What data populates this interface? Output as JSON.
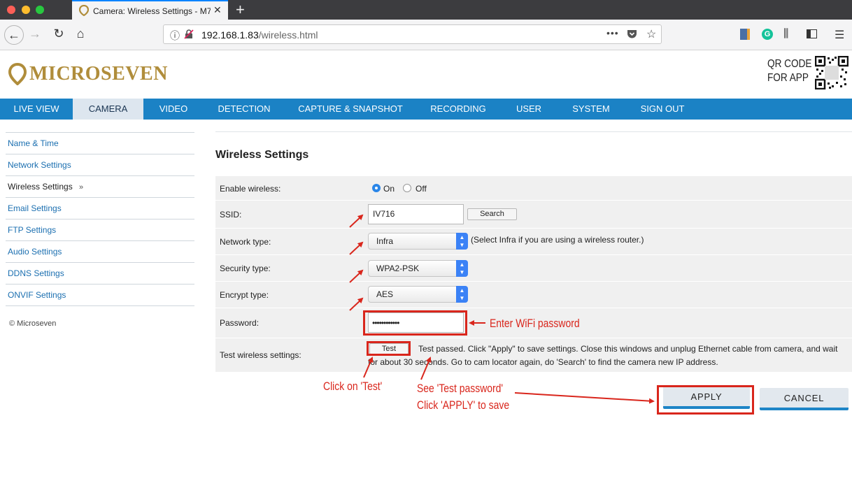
{
  "browser": {
    "tab_title": "Camera: Wireless Settings - M7",
    "url_host": "192.168.1.83",
    "url_path": "/wireless.html"
  },
  "header": {
    "logo": "MICROSEVEN",
    "qr_line1": "QR CODE",
    "qr_line2": "FOR APP"
  },
  "menu": {
    "items": [
      {
        "label": "LIVE VIEW"
      },
      {
        "label": "CAMERA"
      },
      {
        "label": "VIDEO"
      },
      {
        "label": "DETECTION"
      },
      {
        "label": "CAPTURE & SNAPSHOT"
      },
      {
        "label": "RECORDING"
      },
      {
        "label": "USER"
      },
      {
        "label": "SYSTEM"
      },
      {
        "label": "SIGN OUT"
      }
    ],
    "active": "CAMERA"
  },
  "sidebar": {
    "items": [
      {
        "label": "Name & Time"
      },
      {
        "label": "Network Settings"
      },
      {
        "label": "Wireless Settings",
        "suffix": "»"
      },
      {
        "label": "Email Settings"
      },
      {
        "label": "FTP Settings"
      },
      {
        "label": "Audio Settings"
      },
      {
        "label": "DDNS Settings"
      },
      {
        "label": "ONVIF Settings"
      }
    ],
    "copyright": "© Microseven"
  },
  "main": {
    "title": "Wireless Settings",
    "enable_label": "Enable wireless:",
    "on_label": "On",
    "off_label": "Off",
    "ssid_label": "SSID:",
    "ssid_value": "IV716",
    "search_label": "Search",
    "network_label": "Network type:",
    "network_value": "Infra",
    "network_note": "(Select Infra if you are using a wireless router.)",
    "security_label": "Security type:",
    "security_value": "WPA2-PSK",
    "encrypt_label": "Encrypt type:",
    "encrypt_value": "AES",
    "password_label": "Password:",
    "password_value": "••••••••••••",
    "test_label": "Test wireless settings:",
    "test_button": "Test",
    "test_message": "Test passed.  Click \"Apply\" to save settings.  Close this windows and unplug Ethernet cable from camera, and wait for about 30 seconds. Go to cam locator again, do 'Search' to find the camera new IP address.",
    "apply_label": "APPLY",
    "cancel_label": "CANCEL"
  },
  "annotations": {
    "enter_wifi": "Enter WiFi password",
    "click_test": "Click on 'Test'",
    "see_test_1": "See 'Test password'",
    "see_test_2": "Click 'APPLY' to save"
  },
  "colors": {
    "menu_bar": "#1b82c5",
    "logo_gold": "#b08d3b",
    "annotation_red": "#d9261c"
  }
}
